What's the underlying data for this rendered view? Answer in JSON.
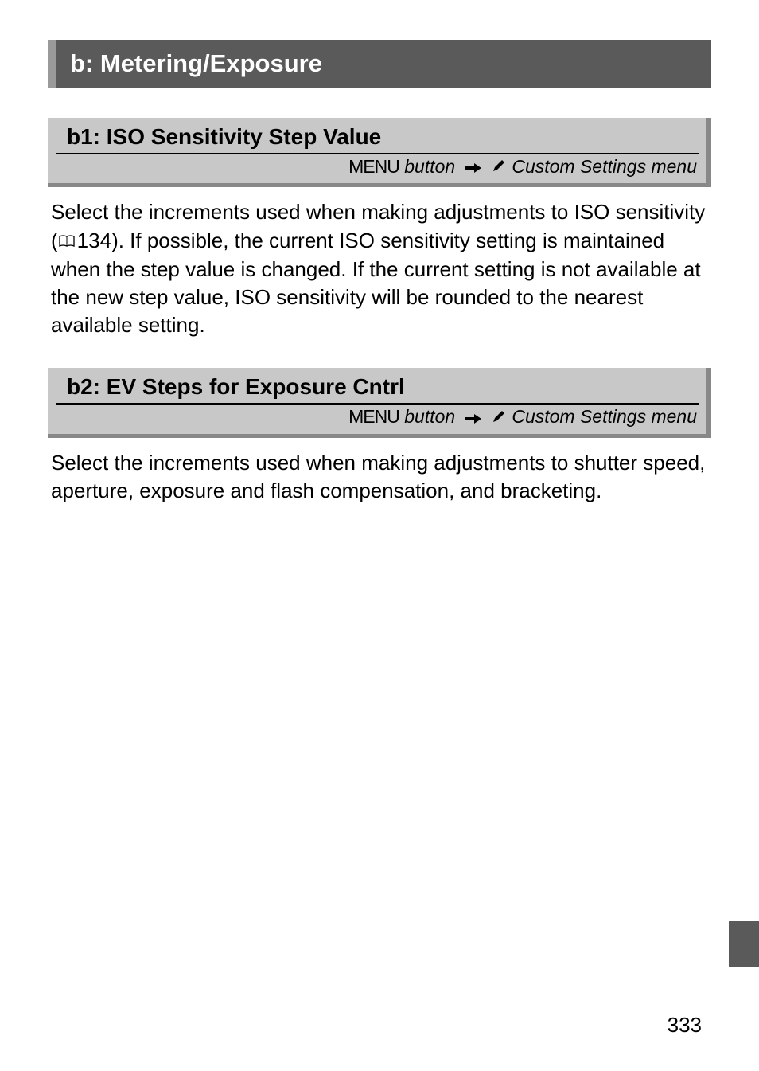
{
  "section": {
    "header": "b: Metering/Exposure"
  },
  "subsections": [
    {
      "title": "b1: ISO Sensitivity Step Value",
      "menu_label": "MENU",
      "button_word": "button",
      "menu_path": "Custom Settings menu",
      "body": "Select the increments used when making adjustments to ISO sensitivity (",
      "page_ref": "134",
      "body_after": ").  If possible, the current ISO sensitivity setting is maintained when the step value is changed.  If the current setting is not available at the new step value, ISO sensitivity will be rounded to the nearest available setting."
    },
    {
      "title": "b2: EV Steps for Exposure Cntrl",
      "menu_label": "MENU",
      "button_word": "button",
      "menu_path": "Custom Settings menu",
      "body": "Select the increments used when making adjustments to shutter speed, aperture, exposure and flash compensation, and bracketing.",
      "page_ref": "",
      "body_after": ""
    }
  ],
  "page_number": "333"
}
